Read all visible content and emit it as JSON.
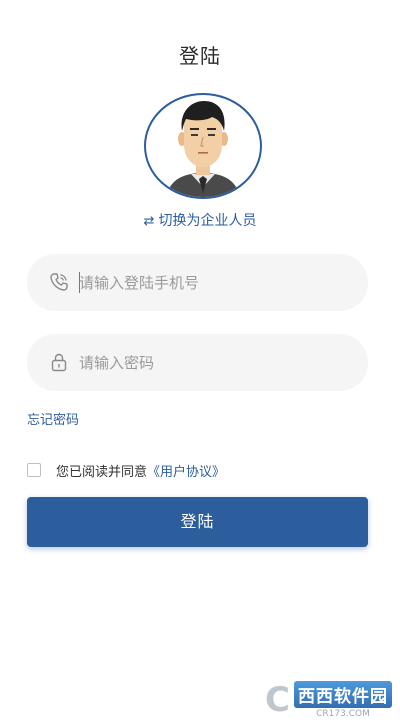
{
  "header": {
    "title": "登陆"
  },
  "avatar": {
    "icon": "user-avatar"
  },
  "switch": {
    "icon": "swap-icon",
    "glyph": "⇄",
    "label": "切换为企业人员"
  },
  "phone_field": {
    "icon": "phone-icon",
    "placeholder": "请输入登陆手机号",
    "value": ""
  },
  "password_field": {
    "icon": "lock-icon",
    "placeholder": "请输入密码",
    "value": ""
  },
  "forgot": {
    "label": "忘记密码"
  },
  "agreement": {
    "checked": false,
    "text": "您已阅读并同意",
    "link": "《用户协议》"
  },
  "login_button": {
    "label": "登陆"
  },
  "watermark": {
    "brand": "西西软件园",
    "url": "CR173.COM"
  },
  "colors": {
    "primary": "#2c5e9e",
    "field_bg": "#f5f5f5",
    "placeholder": "#9a9a9a"
  }
}
